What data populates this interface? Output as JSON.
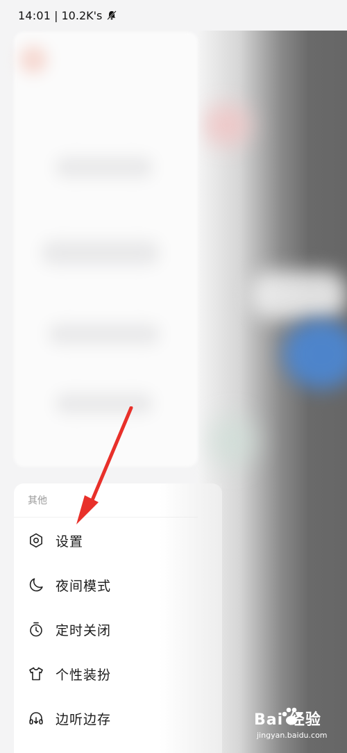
{
  "status_bar": {
    "time": "14:01",
    "separator": "|",
    "net_speed": "10.2K's"
  },
  "others_section": {
    "header": "其他",
    "items": [
      {
        "label": "设置",
        "icon": "hexagon-settings-icon"
      },
      {
        "label": "夜间模式",
        "icon": "moon-icon"
      },
      {
        "label": "定时关闭",
        "icon": "timer-icon"
      },
      {
        "label": "个性装扮",
        "icon": "tshirt-icon"
      },
      {
        "label": "边听边存",
        "icon": "headphones-download-icon"
      }
    ]
  },
  "annotation": {
    "color": "#e8302a",
    "target": "设置"
  },
  "watermark": {
    "logo_text": "Bai 经验",
    "url": "jingyan.baidu.com"
  },
  "colors": {
    "accent_blue": "#4b88d6",
    "card_bg": "#ffffff",
    "drawer_bg": "#f4f4f5"
  }
}
